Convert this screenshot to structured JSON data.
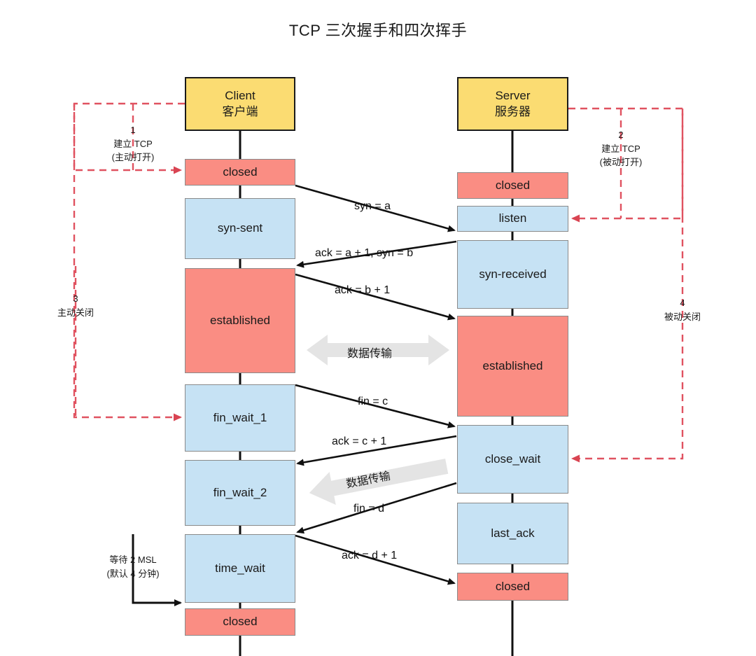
{
  "title": "TCP 三次握手和四次挥手",
  "colors": {
    "header_fill": "#fbdc72",
    "closed_fill": "#fa8d83",
    "established_fill": "#fa8d83",
    "state_fill": "#c6e2f4",
    "dashed_red": "#e05260",
    "gray_arrow": "#e2e2e2",
    "stroke": "#1a1a1a"
  },
  "client": {
    "header_en": "Client",
    "header_cn": "客户端",
    "states": [
      {
        "label": "closed",
        "kind": "closed"
      },
      {
        "label": "syn-sent",
        "kind": "state"
      },
      {
        "label": "established",
        "kind": "established"
      },
      {
        "label": "fin_wait_1",
        "kind": "state"
      },
      {
        "label": "fin_wait_2",
        "kind": "state"
      },
      {
        "label": "time_wait",
        "kind": "state"
      },
      {
        "label": "closed",
        "kind": "closed"
      }
    ]
  },
  "server": {
    "header_en": "Server",
    "header_cn": "服务器",
    "states": [
      {
        "label": "closed",
        "kind": "closed"
      },
      {
        "label": "listen",
        "kind": "state"
      },
      {
        "label": "syn-received",
        "kind": "state"
      },
      {
        "label": "established",
        "kind": "established"
      },
      {
        "label": "close_wait",
        "kind": "state"
      },
      {
        "label": "last_ack",
        "kind": "state"
      },
      {
        "label": "closed",
        "kind": "closed"
      }
    ]
  },
  "messages": [
    {
      "text": "syn = a"
    },
    {
      "text": "ack = a + 1, syn = b"
    },
    {
      "text": "ack = b + 1"
    },
    {
      "text": "fin = c"
    },
    {
      "text": "ack = c + 1"
    },
    {
      "text": "fin = d"
    },
    {
      "text": "ack = d + 1"
    }
  ],
  "data_transfer": {
    "upper": "数据传输",
    "lower": "数据传输"
  },
  "notes": {
    "n1": {
      "num": "1",
      "line1": "建立 TCP",
      "line2": "(主动打开)"
    },
    "n2": {
      "num": "2",
      "line1": "建立 TCP",
      "line2": "(被动打开)"
    },
    "n3": {
      "num": "3",
      "line1": "主动关闭",
      "line2": ""
    },
    "n4": {
      "num": "4",
      "line1": "被动关闭",
      "line2": ""
    },
    "msl": {
      "line1": "等待 2 MSL",
      "line2": "(默认 4 分钟)"
    }
  }
}
